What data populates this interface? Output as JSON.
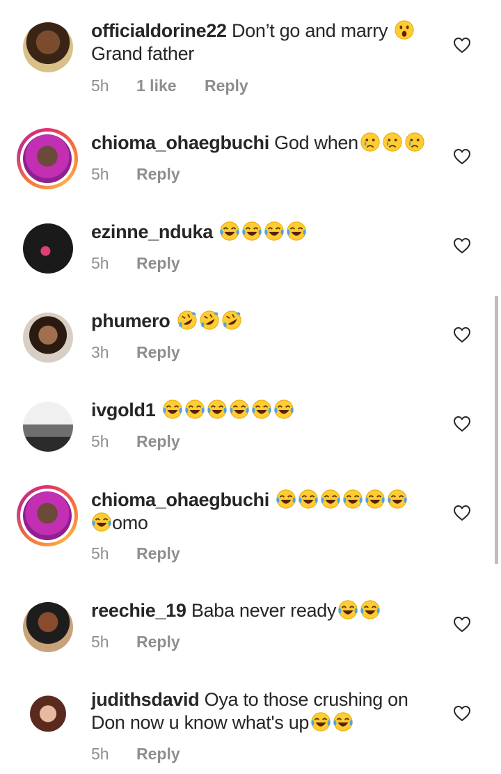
{
  "comments": [
    {
      "username": "officialdorine22",
      "text_parts": [
        " Don’t go and marry ",
        " ",
        "Grand father"
      ],
      "time": "5h",
      "likes": "1 like",
      "reply": "Reply"
    },
    {
      "username": "chioma_ohaegbuchi",
      "text": " God when",
      "time": "5h",
      "reply": "Reply"
    },
    {
      "username": "ezinne_nduka",
      "text": " ",
      "time": "5h",
      "reply": "Reply"
    },
    {
      "username": "phumero",
      "text": " ",
      "time": "3h",
      "reply": "Reply"
    },
    {
      "username": "ivgold1",
      "text": " ",
      "time": "5h",
      "reply": "Reply"
    },
    {
      "username": "chioma_ohaegbuchi",
      "text": "omo",
      "time": "5h",
      "reply": "Reply"
    },
    {
      "username": "reechie_19",
      "text": " Baba never ready",
      "time": "5h",
      "reply": "Reply"
    },
    {
      "username": "judithsdavid",
      "text_line1": " Oya to those crushing on",
      "text_line2": "Don now u know what's up",
      "time": "5h",
      "reply": "Reply"
    }
  ],
  "icons": {
    "heart": "heart-outline-icon",
    "emoji_laugh": "face-with-tears-of-joy-icon",
    "emoji_rofl": "rolling-on-floor-laughing-icon",
    "emoji_cry": "crying-face-icon",
    "emoji_wow": "astonished-face-icon"
  },
  "colors": {
    "username": "#262626",
    "meta": "#8e8e8e",
    "story_ring": "#e1306c",
    "scrollbar": "#bdbdbd"
  }
}
